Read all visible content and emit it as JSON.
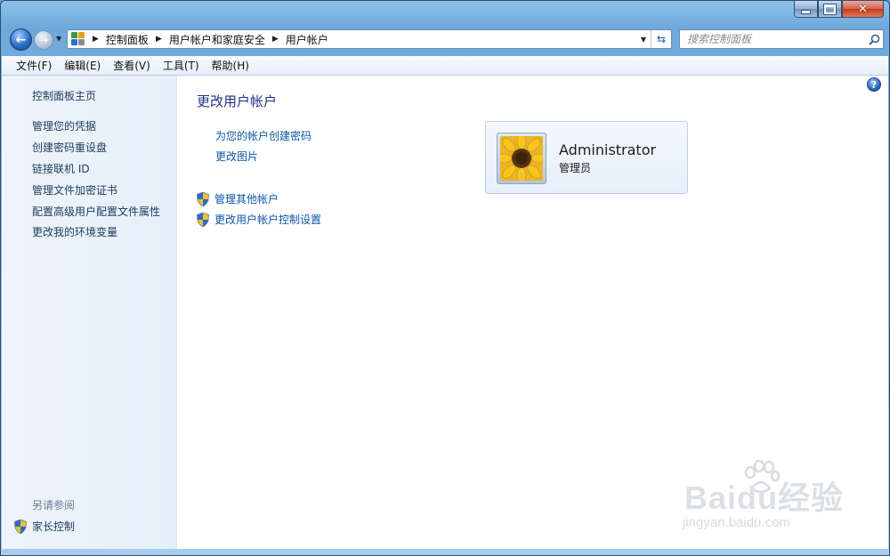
{
  "window": {
    "controls": {
      "minimize": "minimize",
      "maximize": "maximize",
      "close": "close"
    }
  },
  "nav": {
    "breadcrumb": [
      "控制面板",
      "用户帐户和家庭安全",
      "用户帐户"
    ],
    "search_placeholder": "搜索控制面板"
  },
  "menu": {
    "items": [
      "文件(F)",
      "编辑(E)",
      "查看(V)",
      "工具(T)",
      "帮助(H)"
    ]
  },
  "sidebar": {
    "home": "控制面板主页",
    "links": [
      "管理您的凭据",
      "创建密码重设盘",
      "链接联机 ID",
      "管理文件加密证书",
      "配置高级用户配置文件属性",
      "更改我的环境变量"
    ],
    "see_also": "另请参阅",
    "see_also_links": [
      "家长控制"
    ]
  },
  "main": {
    "title": "更改用户帐户",
    "tasks": [
      "为您的帐户创建密码",
      "更改图片"
    ],
    "admin_tasks": [
      "管理其他帐户",
      "更改用户帐户控制设置"
    ],
    "account": {
      "name": "Administrator",
      "role": "管理员"
    }
  },
  "watermark": {
    "main": "Baidu经验",
    "sub": "jingyan.baidu.com"
  },
  "colors": {
    "link": "#0b57a5",
    "title": "#1e3287",
    "sidebar_bg": "#eef4fb",
    "window_frame": "#6ea9dc"
  }
}
